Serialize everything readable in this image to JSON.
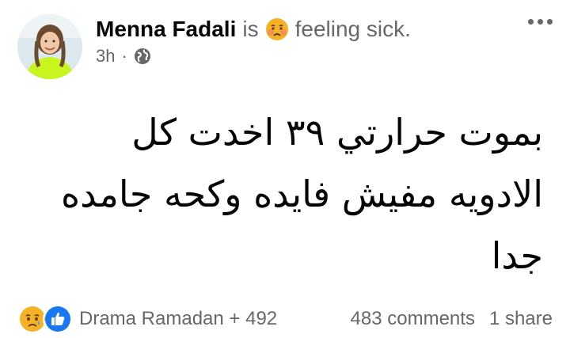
{
  "post": {
    "author": "Menna Fadali",
    "verb": "is",
    "feeling_icon": "sick-face-emoji",
    "feeling": "feeling sick.",
    "time": "3h",
    "separator": "·",
    "privacy_icon": "globe-icon",
    "lines": [
      "بموت حرارتي ٣٩ اخدت كل",
      "الادويه مفيش فايده وكحه جامده",
      "جدا"
    ]
  },
  "reactions": {
    "icons": [
      "sad-reaction-icon",
      "like-reaction-icon"
    ],
    "summary": "Drama Ramadan + 492"
  },
  "stats": {
    "comments": "483 comments",
    "shares": "1 share"
  },
  "colors": {
    "secondary_text": "#65676b",
    "like_blue": "#1877f2",
    "sad_yellow": "#f7b125"
  }
}
